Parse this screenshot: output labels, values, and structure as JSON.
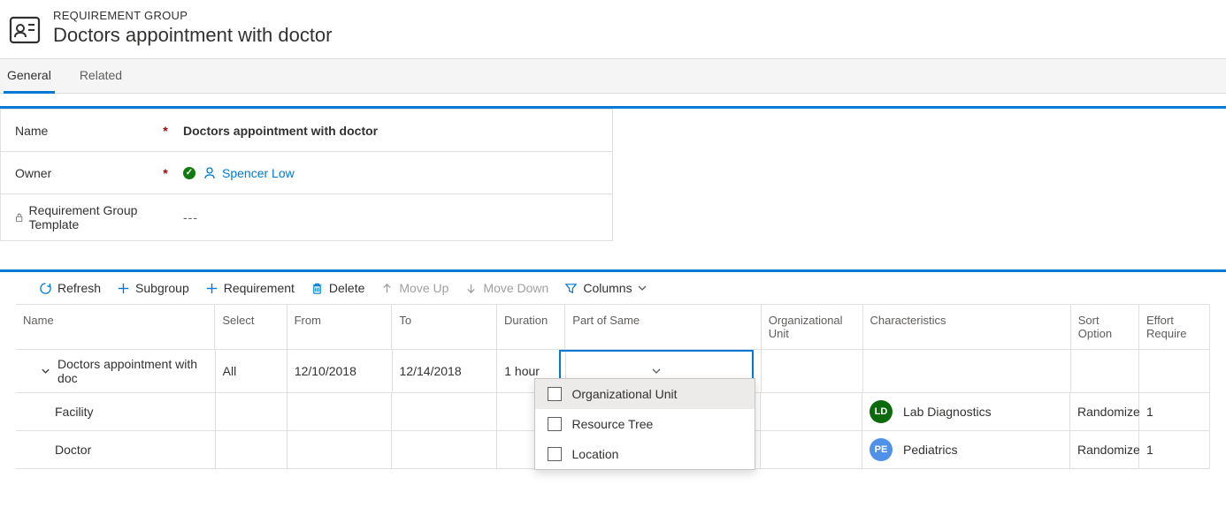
{
  "header": {
    "label": "REQUIREMENT GROUP",
    "title": "Doctors appointment with doctor"
  },
  "tabs": {
    "general": "General",
    "related": "Related"
  },
  "form": {
    "name_label": "Name",
    "name_value": "Doctors appointment with doctor",
    "owner_label": "Owner",
    "owner_value": "Spencer Low",
    "template_label": "Requirement Group Template",
    "template_value": "---"
  },
  "toolbar": {
    "refresh": "Refresh",
    "subgroup": "Subgroup",
    "requirement": "Requirement",
    "delete": "Delete",
    "moveup": "Move Up",
    "movedown": "Move Down",
    "columns": "Columns"
  },
  "grid": {
    "headers": {
      "name": "Name",
      "select": "Select",
      "from": "From",
      "to": "To",
      "duration": "Duration",
      "partof": "Part of Same",
      "orgunit": "Organizational Unit",
      "char": "Characteristics",
      "sort": "Sort Option",
      "effort": "Effort Require"
    },
    "rows": [
      {
        "name": "Doctors appointment with doc",
        "select": "All",
        "from": "12/10/2018",
        "to": "12/14/2018",
        "duration": "1 hour",
        "partof": "",
        "orgunit": "",
        "char_badge": "",
        "char": "",
        "sort": "",
        "effort": ""
      },
      {
        "name": "Facility",
        "select": "",
        "from": "",
        "to": "",
        "duration": "",
        "partof": "",
        "orgunit": "",
        "char_badge": "LD",
        "char": "Lab Diagnostics",
        "sort": "Randomize",
        "effort": "1"
      },
      {
        "name": "Doctor",
        "select": "",
        "from": "",
        "to": "",
        "duration": "",
        "partof": "",
        "orgunit": "",
        "char_badge": "PE",
        "char": "Pediatrics",
        "sort": "Randomize",
        "effort": "1"
      }
    ]
  },
  "dropdown": {
    "opt1": "Organizational Unit",
    "opt2": "Resource Tree",
    "opt3": "Location"
  }
}
